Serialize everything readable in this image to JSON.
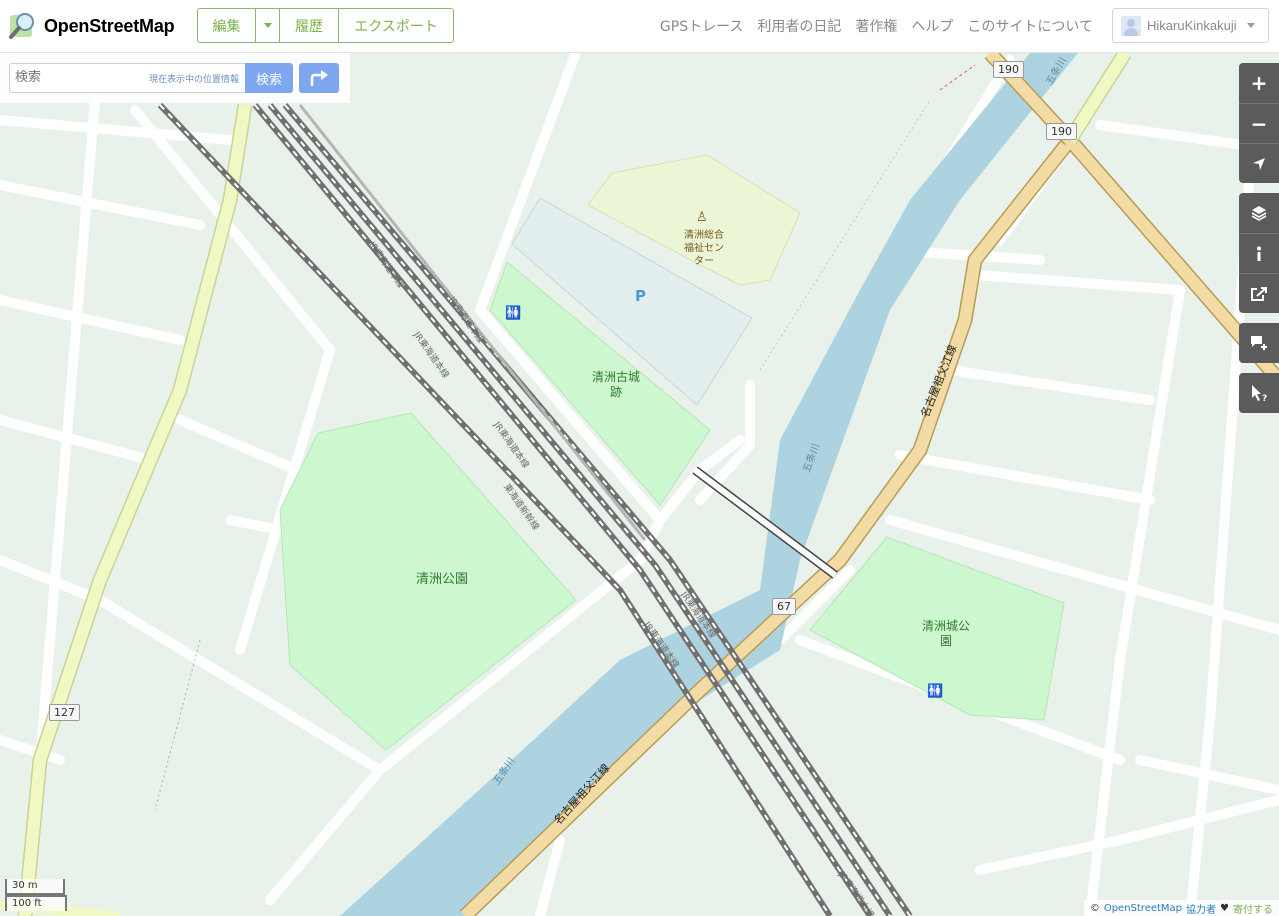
{
  "header": {
    "logo_text": "OpenStreetMap",
    "edit_label": "編集",
    "history_label": "履歴",
    "export_label": "エクスポート",
    "nav": [
      "GPSトレース",
      "利用者の日記",
      "著作権",
      "ヘルプ",
      "このサイトについて"
    ],
    "username": "HikaruKinkakuji"
  },
  "search": {
    "placeholder": "検索",
    "where_am_i": "現在表示中の位置情報",
    "button": "検索"
  },
  "map": {
    "labels": {
      "park_seisu": "清洲公園",
      "castle_ruin_1": "清洲古城",
      "castle_ruin_2": "跡",
      "castle_park_1": "清洲城公",
      "castle_park_2": "園",
      "welfare_1": "清洲総合",
      "welfare_2": "福祉セン",
      "welfare_3": "ター",
      "parking": "P",
      "river_1": "五条川",
      "river_2": "五条川",
      "river_3": "五条川",
      "rail_1": "JR東海道本線",
      "rail_2": "JR東海道本線",
      "rail_3": "JR東海道本線",
      "rail_4": "JR東海道本線",
      "rail_5": "JR東海道本線",
      "rail_6": "JR東海道本線",
      "rail_7": "JR東海道本線",
      "rail_8": "JR東海道本線",
      "shinkansen": "東海道新幹線",
      "road_1": "名古屋祖父江線",
      "road_2": "名古屋祖父江線"
    },
    "shields": [
      "190",
      "190",
      "67",
      "127"
    ]
  },
  "controls": {
    "zoom_in": "+",
    "zoom_out": "−"
  },
  "scale": {
    "metric": "30 m",
    "imperial": "100 ft"
  },
  "attribution": {
    "copyright": "©",
    "osm": "OpenStreetMap",
    "contributors": "協力者",
    "heart": "♥",
    "donate": "寄付する"
  },
  "colors": {
    "map_background": "#e8f1ea",
    "park": "#cdf8cf",
    "water": "#aed3e0",
    "secondary_road": "#f2dba5",
    "tertiary_road": "#f0f8c4",
    "button_blue": "#7ea7ef",
    "edit_green": "#7eb24f"
  }
}
